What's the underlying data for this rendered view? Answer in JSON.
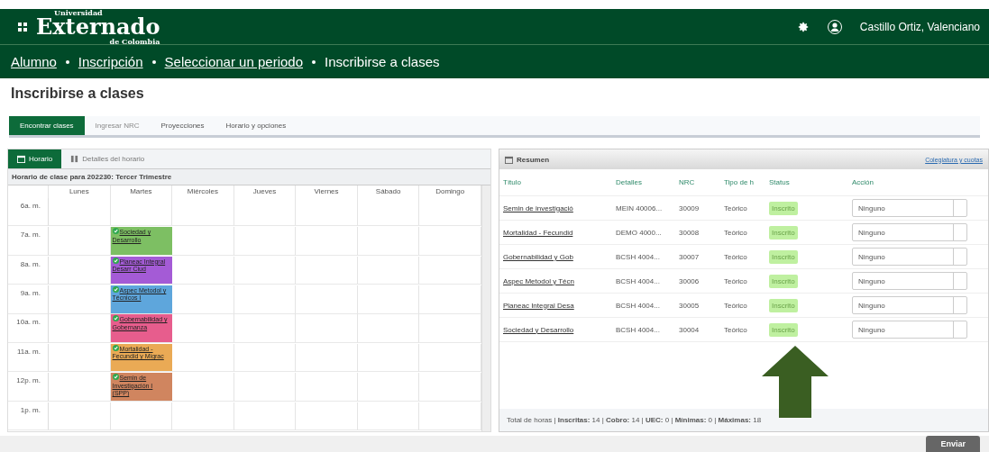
{
  "header": {
    "logo_small": "Universidad",
    "logo_main": "Externado",
    "logo_sub": "de Colombia",
    "user": "Castillo Ortiz, Valenciano"
  },
  "breadcrumb": [
    {
      "label": "Alumno",
      "link": true
    },
    {
      "label": "Inscripción",
      "link": true
    },
    {
      "label": "Seleccionar un periodo",
      "link": true
    },
    {
      "label": "Inscribirse a clases",
      "link": false
    }
  ],
  "page_title": "Inscribirse a clases",
  "tabs": [
    {
      "label": "Encontrar clases",
      "selected": true,
      "disabled": false
    },
    {
      "label": "Ingresar NRC",
      "selected": false,
      "disabled": true
    },
    {
      "label": "Proyecciones",
      "selected": false,
      "disabled": false
    },
    {
      "label": "Horario y opciones",
      "selected": false,
      "disabled": false
    }
  ],
  "schedule": {
    "tabs": [
      {
        "label": "Horario",
        "selected": true
      },
      {
        "label": "Detalles del horario",
        "selected": false
      }
    ],
    "caption": "Horario de clase para 202230: Tercer Trimestre",
    "days": [
      "Lunes",
      "Martes",
      "Miércoles",
      "Jueves",
      "Viernes",
      "Sábado",
      "Domingo"
    ],
    "rows": [
      {
        "time": "6a. m.",
        "cells": [
          null,
          null,
          null,
          null,
          null,
          null,
          null
        ]
      },
      {
        "time": "7a. m.",
        "cells": [
          null,
          {
            "title": "Sociedad y Desarrollo",
            "color": "#7dbf63"
          },
          null,
          null,
          null,
          null,
          null
        ]
      },
      {
        "time": "8a. m.",
        "cells": [
          null,
          {
            "title": "Planeac Integral Desarr Ciud",
            "color": "#a45bd6"
          },
          null,
          null,
          null,
          null,
          null
        ]
      },
      {
        "time": "9a. m.",
        "cells": [
          null,
          {
            "title": "Aspec Metodol y Técnicos I",
            "color": "#5ea6dc"
          },
          null,
          null,
          null,
          null,
          null
        ]
      },
      {
        "time": "10a. m.",
        "cells": [
          null,
          {
            "title": "Gobernabilidad y Gobernanza",
            "color": "#e75d8d"
          },
          null,
          null,
          null,
          null,
          null
        ]
      },
      {
        "time": "11a. m.",
        "cells": [
          null,
          {
            "title": "Mortalidad - Fecundid y Migrac",
            "color": "#eaaa55"
          },
          null,
          null,
          null,
          null,
          null
        ]
      },
      {
        "time": "12p. m.",
        "cells": [
          null,
          {
            "title": "Semin de Investigación I (SPP)",
            "color": "#d0855f"
          },
          null,
          null,
          null,
          null,
          null
        ]
      },
      {
        "time": "1p. m.",
        "cells": [
          null,
          null,
          null,
          null,
          null,
          null,
          null
        ]
      }
    ]
  },
  "summary": {
    "title": "Resumen",
    "link": "Colegiatura y cuotas",
    "columns": [
      "Título",
      "Detalles",
      "NRC",
      "Tipo de h",
      "Status",
      "Acción"
    ],
    "rows": [
      {
        "title": "Semin de investigació",
        "details": "MEIN 40006...",
        "nrc": "30009",
        "type": "Teórico",
        "status": "Inscrito",
        "action": "Ninguno"
      },
      {
        "title": "Mortalidad - Fecundid",
        "details": "DEMO 4000...",
        "nrc": "30008",
        "type": "Teórico",
        "status": "Inscrito",
        "action": "Ninguno"
      },
      {
        "title": "Gobernabilidad y Gob",
        "details": "BCSH 4004...",
        "nrc": "30007",
        "type": "Teórico",
        "status": "Inscrito",
        "action": "Ninguno"
      },
      {
        "title": "Aspec Metodol y Técn",
        "details": "BCSH 4004...",
        "nrc": "30006",
        "type": "Teórico",
        "status": "Inscrito",
        "action": "Ninguno"
      },
      {
        "title": "Planeac Integral Desa",
        "details": "BCSH 4004...",
        "nrc": "30005",
        "type": "Teórico",
        "status": "Inscrito",
        "action": "Ninguno"
      },
      {
        "title": "Sociedad y Desarrollo",
        "details": "BCSH 4004...",
        "nrc": "30004",
        "type": "Teórico",
        "status": "Inscrito",
        "action": "Ninguno"
      }
    ],
    "footer": "Total de horas | **Inscritas:** 14 | **Cobro:** 14 | **UEC:** 0 | **Mínimas:** 0 | **Máximas:** 18"
  },
  "submit": "Enviar"
}
